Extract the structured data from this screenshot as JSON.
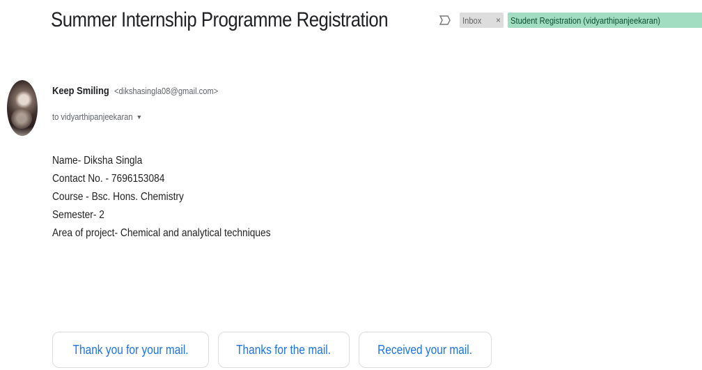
{
  "email": {
    "subject": "Summer Internship Programme Registration",
    "labels": [
      {
        "name": "Inbox",
        "remove": "×",
        "color": "#dddddd"
      },
      {
        "name": "Student Registration (vidyarthipanjeekaran)",
        "remove": "×",
        "color": "#a2dcc1"
      }
    ],
    "importance_icon": "importance-marker-icon",
    "sender": {
      "name": "Keep Smiling",
      "email": "<dikshasingla08@gmail.com>"
    },
    "recipient": "to vidyarthipanjeekaran",
    "recipient_caret": "▼",
    "body_lines": [
      "Name- Diksha Singla",
      "Contact No. - 7696153084",
      "Course - Bsc. Hons. Chemistry",
      "Semester- 2",
      "Area of project- Chemical and analytical techniques"
    ]
  },
  "smart_replies": [
    "Thank you for your mail.",
    "Thanks for the mail.",
    "Received your mail."
  ],
  "colors": {
    "accent": "#1a73e8",
    "text": "#202124",
    "muted": "#5f6368"
  }
}
